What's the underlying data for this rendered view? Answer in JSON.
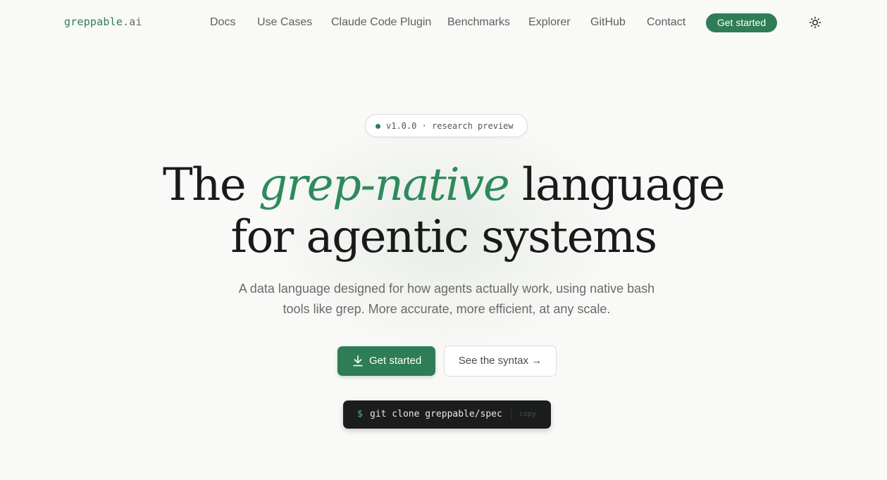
{
  "nav": {
    "logo_brand": "greppable",
    "logo_tld": ".ai",
    "links": [
      "Docs",
      "Use Cases",
      "Claude Code Plugin",
      "Benchmarks",
      "Explorer",
      "GitHub",
      "Contact"
    ],
    "cta_label": "Get started",
    "theme_icon": "sun-icon"
  },
  "hero": {
    "badge": "v1.0.0 · research preview",
    "headline_before": "The ",
    "headline_accent": "grep-native",
    "headline_after": " language",
    "headline_line2": "for agentic systems",
    "subtitle_line1": "A data language designed for how agents actually work, using native bash",
    "subtitle_line2": "tools like grep. More accurate, more efficient, at any scale.",
    "primary_button": "Get started",
    "primary_icon": "download-icon",
    "secondary_button": "See the syntax →"
  },
  "terminal": {
    "prompt": "$",
    "command": "git clone greppable/spec",
    "copy_label": "copy"
  },
  "colors": {
    "accent": "#2e7d57",
    "background": "#f9f9f7",
    "terminal_bg": "#1a1d1b"
  }
}
